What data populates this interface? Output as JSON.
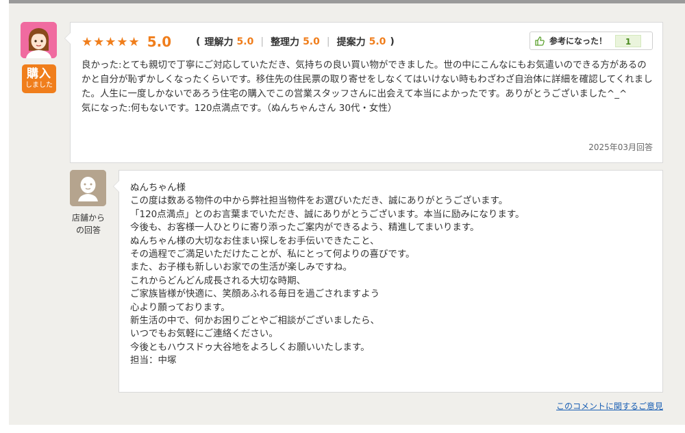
{
  "review": {
    "badge_line1": "購入",
    "badge_line2": "しました",
    "stars": "★★★★★",
    "score": "5.0",
    "open_paren": "(",
    "close_paren": ")",
    "sub_scores": [
      {
        "label": "理解力",
        "value": "5.0"
      },
      {
        "label": "整理力",
        "value": "5.0"
      },
      {
        "label": "提案力",
        "value": "5.0"
      }
    ],
    "separator": "|",
    "helpful_label": "参考になった！",
    "helpful_count": "1",
    "body_good": "良かった:とても親切で丁寧にご対応していただき、気持ちの良い買い物ができました。世の中にこんなにもお気遣いのできる方があるのかと自分が恥ずかしくなったくらいです。移住先の住民票の取り寄せをしなくてはいけない時もわざわざ自治体に詳細を確認してくれました。人生に一度しかないであろう住宅の購入でこの営業スタッフさんに出会えて本当によかったです。ありがとうございました^_^",
    "body_concern": "気になった:何もないです。120点満点です。（ぬんちゃんさん 30代・女性）",
    "date": "2025年03月回答"
  },
  "shop_reply": {
    "label_line1": "店舗から",
    "label_line2": "の回答",
    "lines": [
      "ぬんちゃん様",
      "この度は数ある物件の中から弊社担当物件をお選びいただき、誠にありがとうございます。",
      "「120点満点」とのお言葉までいただき、誠にありがとうございます。本当に励みになります。",
      "今後も、お客様一人ひとりに寄り添ったご案内ができるよう、精進してまいります。",
      "ぬんちゃん様の大切なお住まい探しをお手伝いできたこと、",
      "その過程でご満足いただけたことが、私にとって何よりの喜びです。",
      "また、お子様も新しいお家での生活が楽しみですね。",
      "これからどんどん成長される大切な時期、",
      "ご家族皆様が快適に、笑顔あふれる毎日を過ごされますよう",
      "心より願っております。",
      "新生活の中で、何かお困りごとやご相談がございましたら、",
      "いつでもお気軽にご連絡ください。",
      "今後ともハウスドゥ大谷地をよろしくお願いいたします。",
      "担当：中塚"
    ]
  },
  "footer": {
    "opinion_link": "このコメントに関するご意見"
  },
  "colors": {
    "accent_orange": "#f07e1c",
    "avatar_pink": "#f06ba0",
    "link_blue": "#1a5fb4"
  },
  "icons": {
    "reviewer_avatar": "female-user-icon",
    "shop_avatar": "user-icon",
    "helpful": "thumbs-up-icon"
  }
}
